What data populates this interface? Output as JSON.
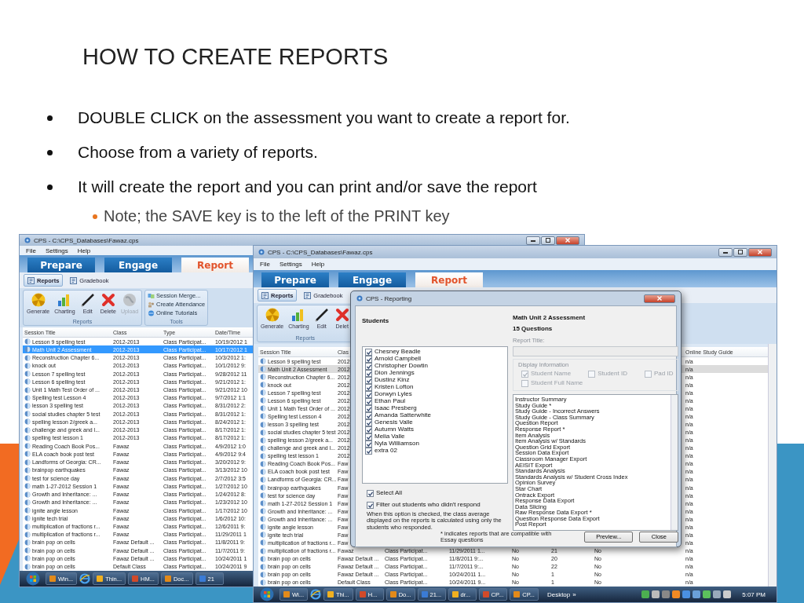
{
  "slide": {
    "title": "HOW TO CREATE REPORTS",
    "bullets": [
      {
        "text": "DOUBLE CLICK on the  assessment you want to create a report for."
      },
      {
        "text": "Choose from a variety of reports."
      },
      {
        "text": "It will create the report and you can print and/or save the report",
        "children": [
          {
            "text": "Note; the SAVE key is to the left of the PRINT key"
          }
        ]
      }
    ]
  },
  "back_window": {
    "title": "CPS - C:\\CPS_Databases\\Fawaz.cps",
    "menu": [
      "File",
      "Settings",
      "Help"
    ],
    "mode_tabs": [
      {
        "label": "Prepare",
        "selected": false
      },
      {
        "label": "Engage",
        "selected": false
      },
      {
        "label": "Report",
        "selected": true
      }
    ],
    "view_tabs": [
      {
        "label": "Reports",
        "selected": true
      },
      {
        "label": "Gradebook",
        "selected": false
      }
    ],
    "ribbon": {
      "label": "Reports",
      "buttons": [
        {
          "label": "Generate",
          "disabled": false
        },
        {
          "label": "Charting",
          "disabled": false
        },
        {
          "label": "Edit",
          "disabled": false
        },
        {
          "label": "Delete",
          "disabled": false
        },
        {
          "label": "Upload",
          "disabled": true
        }
      ]
    },
    "tools": {
      "label": "Tools",
      "items": [
        "Session Merge...",
        "Create Attendance",
        "Online Tutorials"
      ]
    },
    "table": {
      "focused": true,
      "columns": [
        "Session Title",
        "Class",
        "Type",
        "Date/Time"
      ],
      "rows": [
        {
          "selected": false,
          "cells": {
            "title": "Lesson 9 spelling test",
            "class": "2012-2013",
            "type": "Class Participat...",
            "date": "10/19/2012 1"
          }
        },
        {
          "selected": true,
          "cells": {
            "title": "Math Unit 2 Assessment",
            "class": "2012-2013",
            "type": "Class Participat...",
            "date": "10/17/2012 1"
          }
        },
        {
          "selected": false,
          "cells": {
            "title": "Reconstruction Chapter 6...",
            "class": "2012-2013",
            "type": "Class Participat...",
            "date": "10/3/2012 1:"
          }
        },
        {
          "selected": false,
          "cells": {
            "title": "knock out",
            "class": "2012-2013",
            "type": "Class Participat...",
            "date": "10/1/2012 9:"
          }
        },
        {
          "selected": false,
          "cells": {
            "title": "Lesson 7 spelling test",
            "class": "2012-2013",
            "type": "Class Participat...",
            "date": "9/28/2012 11"
          }
        },
        {
          "selected": false,
          "cells": {
            "title": "Lesson 6 spelling test",
            "class": "2012-2013",
            "type": "Class Participat...",
            "date": "9/21/2012 1:"
          }
        },
        {
          "selected": false,
          "cells": {
            "title": "Unit 1 Math Test Order of ...",
            "class": "2012-2013",
            "type": "Class Participat...",
            "date": "9/21/2012 10"
          }
        },
        {
          "selected": false,
          "cells": {
            "title": "Spelling test Lesson 4",
            "class": "2012-2013",
            "type": "Class Participat...",
            "date": "9/7/2012 1:1"
          }
        },
        {
          "selected": false,
          "cells": {
            "title": "lesson 3 spelling test",
            "class": "2012-2013",
            "type": "Class Participat...",
            "date": "8/31/2012 2:"
          }
        },
        {
          "selected": false,
          "cells": {
            "title": "social studies chapter 5 test",
            "class": "2012-2013",
            "type": "Class Participat...",
            "date": "8/31/2012 1:"
          }
        },
        {
          "selected": false,
          "cells": {
            "title": "spelling lesson 2/greek a...",
            "class": "2012-2013",
            "type": "Class Participat...",
            "date": "8/24/2012 1:"
          }
        },
        {
          "selected": false,
          "cells": {
            "title": "challenge and greek and l...",
            "class": "2012-2013",
            "type": "Class Participat...",
            "date": "8/17/2012 1:"
          }
        },
        {
          "selected": false,
          "cells": {
            "title": "spelling test lesson 1",
            "class": "2012-2013",
            "type": "Class Participat...",
            "date": "8/17/2012 1:"
          }
        },
        {
          "selected": false,
          "cells": {
            "title": "Reading Coach Book Pos...",
            "class": "Fawaz",
            "type": "Class Participat...",
            "date": "4/9/2012 1:0"
          }
        },
        {
          "selected": false,
          "cells": {
            "title": "ELA coach book post test",
            "class": "Fawaz",
            "type": "Class Participat...",
            "date": "4/9/2012 9:4"
          }
        },
        {
          "selected": false,
          "cells": {
            "title": "Landforms of Georgia: CR...",
            "class": "Fawaz",
            "type": "Class Participat...",
            "date": "3/20/2012 9:"
          }
        },
        {
          "selected": false,
          "cells": {
            "title": "brainpop earthquakes",
            "class": "Fawaz",
            "type": "Class Participat...",
            "date": "3/13/2012 10"
          }
        },
        {
          "selected": false,
          "cells": {
            "title": "test for science day",
            "class": "Fawaz",
            "type": "Class Participat...",
            "date": "2/7/2012 3:5"
          }
        },
        {
          "selected": false,
          "cells": {
            "title": "math 1-27-2012 Session 1",
            "class": "Fawaz",
            "type": "Class Participat...",
            "date": "1/27/2012 10"
          }
        },
        {
          "selected": false,
          "cells": {
            "title": "Growth and Inheritance: ...",
            "class": "Fawaz",
            "type": "Class Participat...",
            "date": "1/24/2012 8:"
          }
        },
        {
          "selected": false,
          "cells": {
            "title": "Growth and Inheritance: ...",
            "class": "Fawaz",
            "type": "Class Participat...",
            "date": "1/23/2012 10"
          }
        },
        {
          "selected": false,
          "cells": {
            "title": "ignite angle lesson",
            "class": "Fawaz",
            "type": "Class Participat...",
            "date": "1/17/2012 10"
          }
        },
        {
          "selected": false,
          "cells": {
            "title": "ignite tech trial",
            "class": "Fawaz",
            "type": "Class Participat...",
            "date": "1/6/2012 10:"
          }
        },
        {
          "selected": false,
          "cells": {
            "title": "multiplication of fractions r...",
            "class": "Fawaz",
            "type": "Class Participat...",
            "date": "12/6/2011 9:"
          }
        },
        {
          "selected": false,
          "cells": {
            "title": "multiplication of fractions r...",
            "class": "Fawaz",
            "type": "Class Participat...",
            "date": "11/29/2011 1"
          }
        },
        {
          "selected": false,
          "cells": {
            "title": "brain pop on cells",
            "class": "Fawaz Default ...",
            "type": "Class Participat...",
            "date": "11/8/2011 9:"
          }
        },
        {
          "selected": false,
          "cells": {
            "title": "brain pop on cells",
            "class": "Fawaz Default ...",
            "type": "Class Participat...",
            "date": "11/7/2011 9:"
          }
        },
        {
          "selected": false,
          "cells": {
            "title": "brain pop on cells",
            "class": "Fawaz Default ...",
            "type": "Class Participat...",
            "date": "10/24/2011 1"
          }
        },
        {
          "selected": false,
          "cells": {
            "title": "brain pop on cells",
            "class": "Default Class",
            "type": "Class Participat...",
            "date": "10/24/2011 9"
          }
        }
      ]
    },
    "taskbar": {
      "items": [
        {
          "kind": "app",
          "label": "Win..."
        },
        {
          "kind": "icon"
        },
        {
          "kind": "app",
          "label": "Thin..."
        },
        {
          "kind": "app",
          "label": "HM..."
        },
        {
          "kind": "app",
          "label": "Doc..."
        },
        {
          "kind": "app",
          "label": "21"
        }
      ]
    }
  },
  "front_window": {
    "title": "CPS - C:\\CPS_Databases\\Fawaz.cps",
    "menu": [
      "File",
      "Settings",
      "Help"
    ],
    "mode_tabs": [
      {
        "label": "Prepare",
        "selected": false
      },
      {
        "label": "Engage",
        "selected": false
      },
      {
        "label": "Report",
        "selected": true
      }
    ],
    "view_tabs": [
      {
        "label": "Reports",
        "selected": true
      },
      {
        "label": "Gradebook",
        "selected": false
      }
    ],
    "ribbon": {
      "label": "Reports",
      "buttons": [
        {
          "label": "Generate",
          "disabled": false
        },
        {
          "label": "Charting",
          "disabled": false
        },
        {
          "label": "Edit",
          "disabled": false
        },
        {
          "label": "Delet",
          "disabled": false
        }
      ]
    },
    "table": {
      "focused": false,
      "columns": [
        "Session Title",
        "Clas",
        "Online Study Guide"
      ],
      "rows": [
        {
          "selected": false,
          "cells": {
            "title": "Lesson 9 spelling test",
            "class": "2012",
            "guide": "n/a"
          }
        },
        {
          "selected": true,
          "cells": {
            "title": "Math Unit 2 Assessment",
            "class": "2012",
            "guide": "n/a"
          }
        },
        {
          "selected": false,
          "cells": {
            "title": "Reconstruction Chapter 6...",
            "class": "2012",
            "guide": "n/a"
          }
        },
        {
          "selected": false,
          "cells": {
            "title": "knock out",
            "class": "2012",
            "guide": "n/a"
          }
        },
        {
          "selected": false,
          "cells": {
            "title": "Lesson 7 spelling test",
            "class": "2012",
            "guide": "n/a"
          }
        },
        {
          "selected": false,
          "cells": {
            "title": "Lesson 6 spelling test",
            "class": "2012",
            "guide": "n/a"
          }
        },
        {
          "selected": false,
          "cells": {
            "title": "Unit 1 Math Test Order of ...",
            "class": "2012",
            "guide": "n/a"
          }
        },
        {
          "selected": false,
          "cells": {
            "title": "Spelling test Lesson 4",
            "class": "2012",
            "guide": "n/a"
          }
        },
        {
          "selected": false,
          "cells": {
            "title": "lesson 3 spelling test",
            "class": "2012",
            "guide": "n/a"
          }
        },
        {
          "selected": false,
          "cells": {
            "title": "social studies chapter 5 test",
            "class": "2012",
            "guide": "n/a"
          }
        },
        {
          "selected": false,
          "cells": {
            "title": "spelling lesson 2/greek a...",
            "class": "2012",
            "guide": "n/a"
          }
        },
        {
          "selected": false,
          "cells": {
            "title": "challenge and greek and l...",
            "class": "2012",
            "guide": "n/a"
          }
        },
        {
          "selected": false,
          "cells": {
            "title": "spelling test lesson 1",
            "class": "2012",
            "guide": "n/a"
          }
        },
        {
          "selected": false,
          "cells": {
            "title": "Reading Coach Book Pos...",
            "class": "Faw",
            "guide": "n/a"
          }
        },
        {
          "selected": false,
          "cells": {
            "title": "ELA coach book post test",
            "class": "Faw",
            "guide": "n/a"
          }
        },
        {
          "selected": false,
          "cells": {
            "title": "Landforms of Georgia: CR...",
            "class": "Faw",
            "guide": "n/a"
          }
        },
        {
          "selected": false,
          "cells": {
            "title": "brainpop earthquakes",
            "class": "Faw",
            "guide": "n/a"
          }
        },
        {
          "selected": false,
          "cells": {
            "title": "test for science day",
            "class": "Faw",
            "guide": "n/a"
          }
        },
        {
          "selected": false,
          "cells": {
            "title": "math 1-27-2012 Session 1",
            "class": "Faw",
            "guide": "n/a"
          }
        },
        {
          "selected": false,
          "cells": {
            "title": "Growth and Inheritance: ...",
            "class": "Faw",
            "guide": "n/a"
          }
        },
        {
          "selected": false,
          "cells": {
            "title": "Growth and Inheritance: ...",
            "class": "Faw",
            "guide": "n/a"
          }
        },
        {
          "selected": false,
          "cells": {
            "title": "ignite angle lesson",
            "class": "Faw",
            "guide": "n/a"
          }
        },
        {
          "selected": false,
          "cells": {
            "title": "ignite tech trial",
            "class": "Faw",
            "guide": "n/a"
          }
        },
        {
          "selected": false,
          "cells": {
            "title": "multiplication of fractions r...",
            "class": "Faw",
            "guide": "n/a"
          }
        },
        {
          "selected": false,
          "cells": {
            "title": "multiplication of fractions r...",
            "class": "Fawaz",
            "type": "Class Participat...",
            "date": "11/29/2011 1...",
            "c5": "No",
            "c6": "21",
            "c7": "No",
            "guide": "n/a"
          }
        },
        {
          "selected": false,
          "cells": {
            "title": "brain pop on cells",
            "class": "Fawaz Default ...",
            "type": "Class Participat...",
            "date": "11/8/2011 9:...",
            "c5": "No",
            "c6": "20",
            "c7": "No",
            "guide": "n/a"
          }
        },
        {
          "selected": false,
          "cells": {
            "title": "brain pop on cells",
            "class": "Fawaz Default ...",
            "type": "Class Participat...",
            "date": "11/7/2011 9:...",
            "c5": "No",
            "c6": "22",
            "c7": "No",
            "guide": "n/a"
          }
        },
        {
          "selected": false,
          "cells": {
            "title": "brain pop on cells",
            "class": "Fawaz Default ...",
            "type": "Class Participat...",
            "date": "10/24/2011 1...",
            "c5": "No",
            "c6": "1",
            "c7": "No",
            "guide": "n/a"
          }
        },
        {
          "selected": false,
          "cells": {
            "title": "brain pop on cells",
            "class": "Default Class",
            "type": "Class Participat...",
            "date": "10/24/2011 9...",
            "c5": "No",
            "c6": "1",
            "c7": "No",
            "guide": "n/a"
          }
        }
      ]
    },
    "taskbar": {
      "items": [
        {
          "kind": "app",
          "label": "Wi..."
        },
        {
          "kind": "icon"
        },
        {
          "kind": "app",
          "label": "Thi..."
        },
        {
          "kind": "app",
          "label": "H..."
        },
        {
          "kind": "app",
          "label": "Do..."
        },
        {
          "kind": "app",
          "label": "21..."
        },
        {
          "kind": "app",
          "label": "dr..."
        },
        {
          "kind": "app",
          "label": "CP..."
        },
        {
          "kind": "app",
          "label": "CP..."
        }
      ],
      "desktop": "Desktop",
      "more": "»",
      "clock": "5:07 PM"
    }
  },
  "dialog": {
    "title": "CPS - Reporting",
    "students_label": "Students",
    "students": [
      {
        "name": "Chesney Beadle",
        "checked": true
      },
      {
        "name": "Arnold Campbell",
        "checked": true
      },
      {
        "name": "Christopher Dowtin",
        "checked": true
      },
      {
        "name": "Dion Jennings",
        "checked": true
      },
      {
        "name": "Dustinz Kinz",
        "checked": true
      },
      {
        "name": "Kristen Lofton",
        "checked": true
      },
      {
        "name": "Dorwyn Lyles",
        "checked": true
      },
      {
        "name": "Ethan Paul",
        "checked": true
      },
      {
        "name": "Isaac Presberg",
        "checked": true
      },
      {
        "name": "Amanda Satterwhite",
        "checked": true
      },
      {
        "name": "Genesis Valle",
        "checked": true
      },
      {
        "name": "Autumn Watts",
        "checked": true
      },
      {
        "name": "Melia Valle",
        "checked": true
      },
      {
        "name": "Nyla Williamson",
        "checked": true
      },
      {
        "name": "extra 02",
        "checked": true
      }
    ],
    "select_all": {
      "label": "Select All",
      "checked": true
    },
    "filter": {
      "label": "Filter out students who didn't respond",
      "checked": true
    },
    "filter_note": "When this option is checked, the class average displayed on the reports is calculated using only the students who responded.",
    "assessment": "Math Unit 2 Assessment",
    "questions": "15 Questions",
    "report_title_label": "Report Title:",
    "display_info": {
      "label": "Display Information",
      "disabled": true,
      "options": [
        {
          "label": "Student Name",
          "checked": true
        },
        {
          "label": "Student ID",
          "checked": false
        },
        {
          "label": "Pad ID",
          "checked": false
        },
        {
          "label": "Student Full Name",
          "checked": false
        }
      ]
    },
    "reports": [
      "Instructor Summary",
      "Study Guide *",
      "Study Guide - Incorrect Answers",
      "Study Guide - Class Summary",
      "Question Report",
      "Response Report *",
      "Item Analysis",
      "Item Analysis w/ Standards",
      "Question Grid Export",
      "Session Data Export",
      "Classroom Manager Export",
      "AEISIT Export",
      "Standards Analysis",
      "Standards Analysis w/ Student Cross Index",
      "Opinion Survey",
      "Star Chart",
      "Ontrack Export",
      "Response Data Export",
      "Data Slicing",
      "Raw Response Data Export *",
      "Question Response Data Export",
      "Post Report"
    ],
    "note": "* indicates reports that are compatible with Essay questions",
    "buttons": [
      "Preview...",
      "Close"
    ]
  }
}
